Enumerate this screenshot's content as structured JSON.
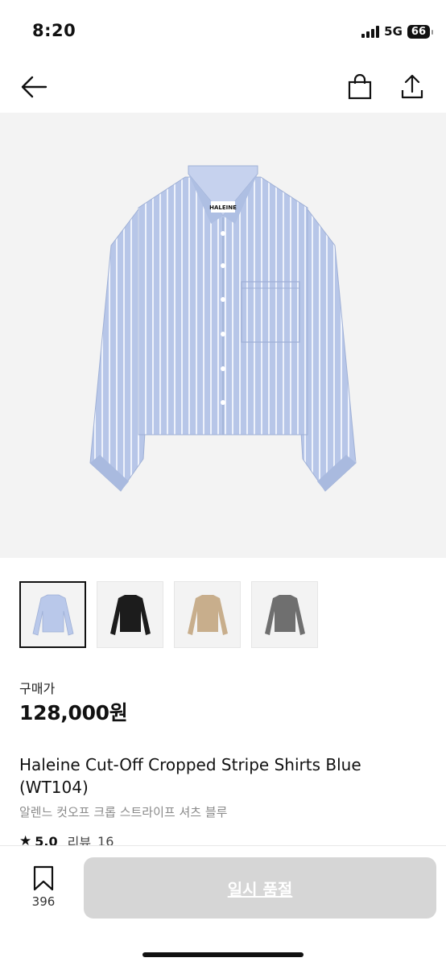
{
  "status": {
    "time": "8:20",
    "network": "5G",
    "battery": "66"
  },
  "nav": {
    "back_icon": "back-arrow-icon",
    "cart_icon": "shopping-bag-icon",
    "share_icon": "share-icon"
  },
  "product": {
    "price_label": "구매가",
    "price": "128,000원",
    "title": "Haleine Cut-Off Cropped Stripe Shirts Blue (WT104)",
    "subtitle": "알렌느 컷오프 크롭 스트라이프 셔츠 블루",
    "rating": "5.0",
    "review_label": "리뷰",
    "review_count": "16",
    "brand_tag": "HALEINE"
  },
  "thumbnails": [
    {
      "color": "#b9c8ea",
      "name": "blue stripe",
      "selected": true
    },
    {
      "color": "#1c1c1c",
      "name": "black",
      "selected": false
    },
    {
      "color": "#c8ae8c",
      "name": "beige",
      "selected": false
    },
    {
      "color": "#6f6f6f",
      "name": "gray check",
      "selected": false
    }
  ],
  "bottom": {
    "bookmark_count": "396",
    "action_label": "일시 품절"
  },
  "colors": {
    "hero_bg": "#f3f3f3",
    "shirt": "#b7c6e8",
    "disabled_button": "#d6d6d6"
  }
}
